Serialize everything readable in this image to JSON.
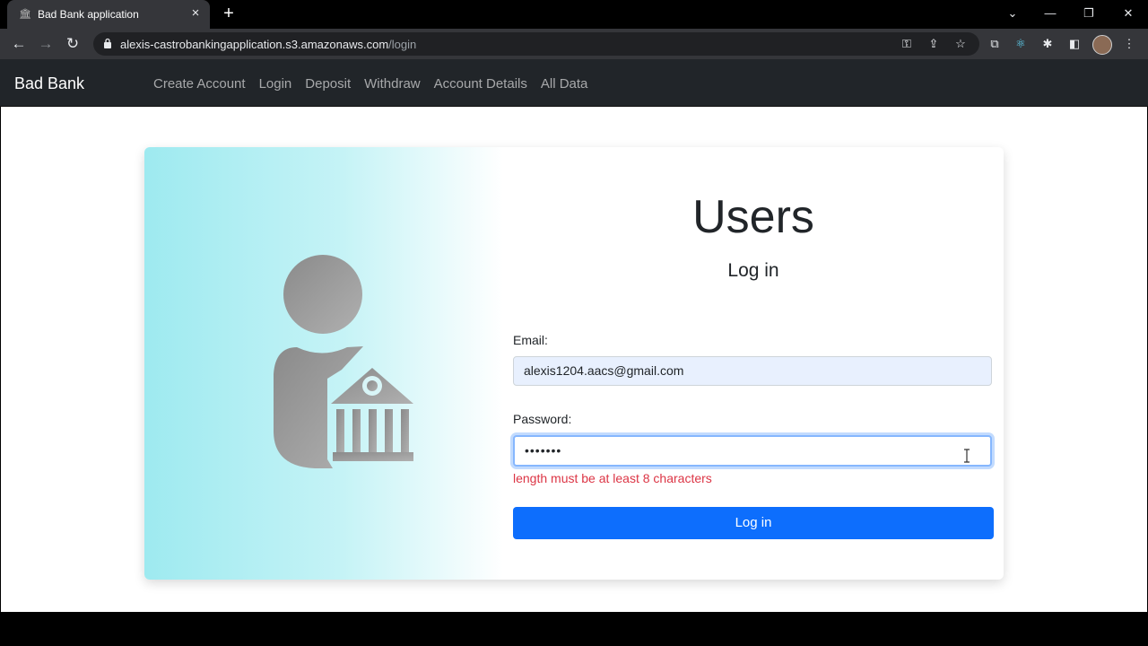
{
  "browser": {
    "tab_title": "Bad Bank application",
    "tab_close": "×",
    "new_tab": "+",
    "url_host": "alexis-castrobankingapplication.s3.amazonaws.com",
    "url_path": "/login",
    "window_controls": {
      "minimize": "—",
      "restore": "❐",
      "close": "✕"
    },
    "nav": {
      "back": "←",
      "forward": "→",
      "reload": "↻"
    },
    "icons": [
      "key-icon",
      "share-icon",
      "star-icon",
      "extension-a-icon",
      "react-icon",
      "puzzle-icon",
      "sidepanel-icon",
      "avatar",
      "menu-icon"
    ]
  },
  "navbar": {
    "brand": "Bad Bank",
    "links": [
      "Create Account",
      "Login",
      "Deposit",
      "Withdraw",
      "Account Details",
      "All Data"
    ]
  },
  "card": {
    "heading": "Users",
    "subheading": "Log in",
    "email_label": "Email:",
    "email_value": "alexis1204.aacs@gmail.com",
    "password_label": "Password:",
    "password_value": "•••••••",
    "error_text": "length must be at least 8 characters",
    "submit_label": "Log in"
  },
  "colors": {
    "navbar": "#212529",
    "primary": "#0d6efd",
    "error": "#dc3545",
    "illustration_gradient_start": "#9eeaf0"
  }
}
